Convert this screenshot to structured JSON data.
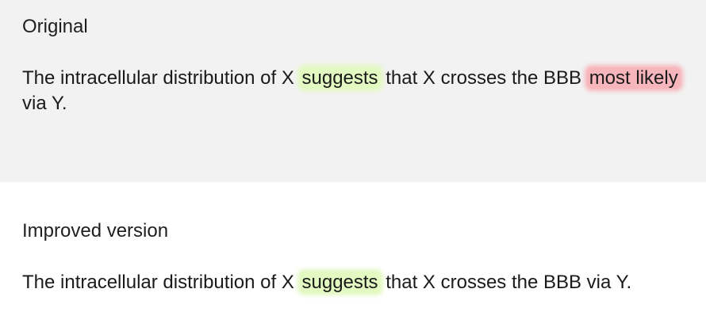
{
  "original": {
    "heading": "Original",
    "text_before": "The intracellular distribution of X ",
    "highlight_hedge": "suggests",
    "text_middle": " that X crosses the BBB ",
    "highlight_overhedge": "most likely",
    "text_after": " via Y."
  },
  "improved": {
    "heading": "Improved version",
    "text_before": "The intracellular distribution of X ",
    "highlight_hedge": "suggests",
    "text_after": " that X crosses the BBB via Y."
  },
  "colors": {
    "panel_original_bg": "#f2f2f2",
    "highlight_green": "#e3f9c2",
    "highlight_red": "#f6b6bb"
  }
}
